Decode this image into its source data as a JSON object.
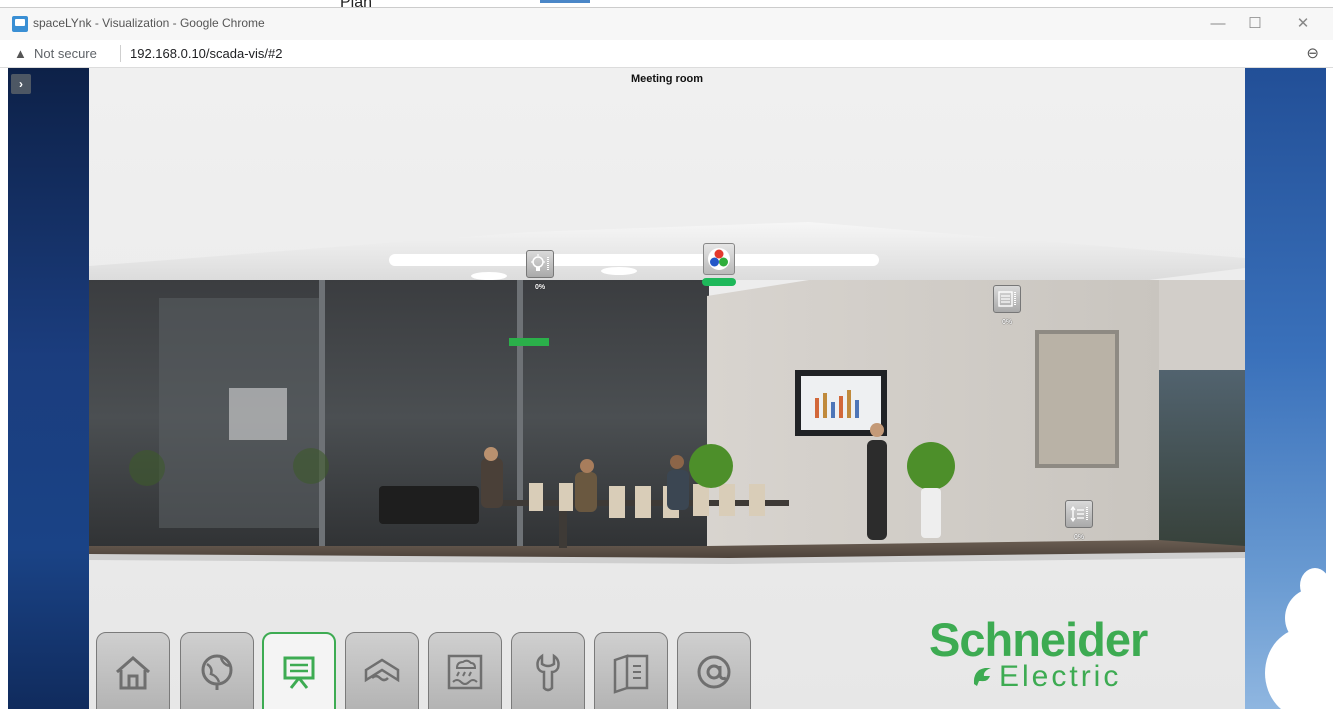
{
  "window": {
    "above_text": "Plan",
    "title": "spaceLYnk - Visualization - Google Chrome",
    "controls": {
      "minimize": "—",
      "maximize": "☐",
      "close": "✕"
    }
  },
  "address_bar": {
    "security": "Not secure",
    "url": "192.168.0.10/scada-vis/#2"
  },
  "sidebar_toggle": "›",
  "page": {
    "title": "Meeting room",
    "controls": {
      "light": {
        "value": "0%"
      },
      "blind_top": {
        "value": "0%"
      },
      "blind_bottom": {
        "value": "0%"
      },
      "rgb_level": 1.0
    },
    "colors": {
      "accent": "#3dab52",
      "rgb_bar": "#1eb85a"
    }
  },
  "nav": [
    {
      "icon": "home-icon"
    },
    {
      "icon": "globe-icon"
    },
    {
      "icon": "presentation-icon",
      "active": true
    },
    {
      "icon": "hvac-icon"
    },
    {
      "icon": "weather-icon"
    },
    {
      "icon": "wrench-icon"
    },
    {
      "icon": "book-icon"
    },
    {
      "icon": "at-icon"
    }
  ],
  "logo": {
    "line1": "Schneider",
    "line2": "Electric"
  }
}
